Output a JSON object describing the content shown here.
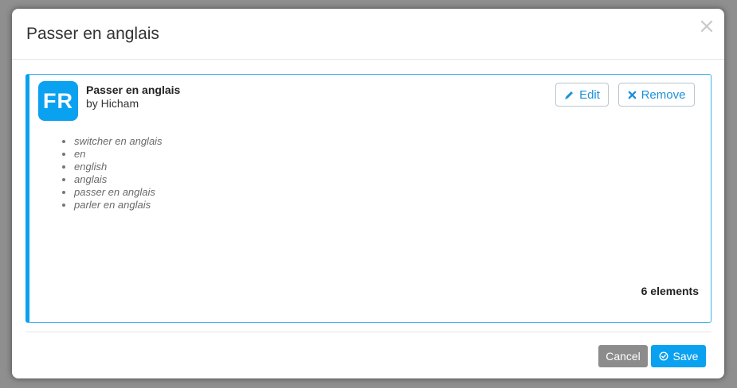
{
  "modal": {
    "title": "Passer en anglais",
    "close_icon": "close-icon"
  },
  "card": {
    "avatar_text": "FR",
    "title": "Passer en anglais",
    "author": "by Hicham",
    "edit_label": "Edit",
    "edit_icon": "pencil-icon",
    "remove_label": "Remove",
    "remove_icon": "x-icon",
    "phrases": [
      "switcher en anglais",
      "en",
      "english",
      "anglais",
      "passer en anglais",
      "parler en anglais"
    ],
    "count_label": "6 elements"
  },
  "footer": {
    "cancel_label": "Cancel",
    "save_label": "Save",
    "save_icon": "check-circle-icon"
  },
  "colors": {
    "accent": "#0aa1f0",
    "cancel": "#8c8c8c",
    "backdrop": "#8f8f8f"
  }
}
